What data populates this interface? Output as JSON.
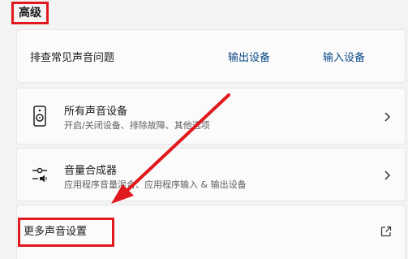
{
  "section": {
    "title": "高级"
  },
  "troubleshoot": {
    "label": "排查常见声音问题",
    "output_link": "输出设备",
    "input_link": "输入设备"
  },
  "all_devices": {
    "title": "所有声音设备",
    "description": "开启/关闭设备、排除故障、其他选项",
    "icon": "speaker-icon"
  },
  "mixer": {
    "title": "音量合成器",
    "description": "应用程序音量混合、应用程序输入 & 输出设备",
    "icon": "volume-mixer-icon"
  },
  "more_settings": {
    "label": "更多声音设置",
    "icon": "external-link-icon"
  },
  "annotations": {
    "highlight_color": "#e0191e"
  }
}
